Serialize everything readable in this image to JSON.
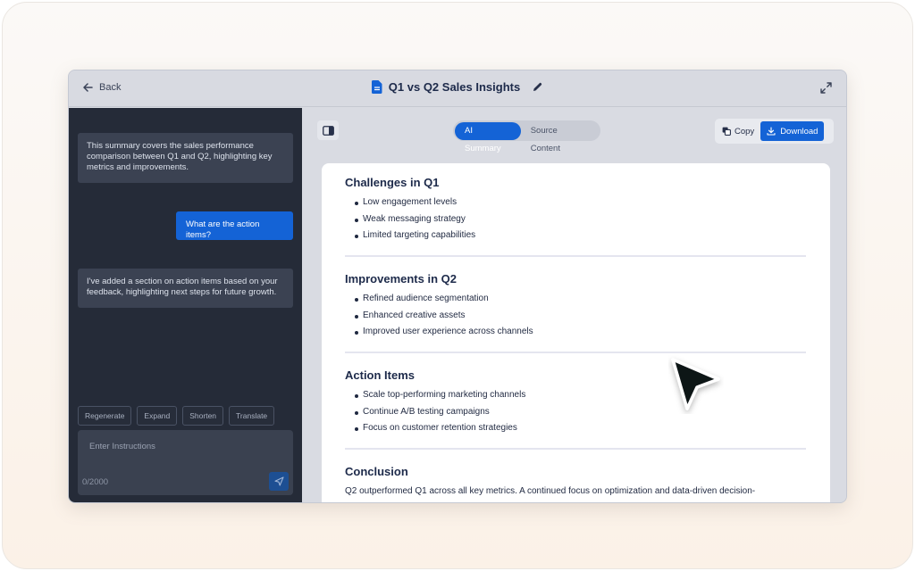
{
  "header": {
    "back_label": "Back",
    "title": "Q1 vs Q2 Sales Insights"
  },
  "chat": {
    "messages": [
      {
        "role": "ai",
        "text": "This summary covers the sales performance comparison between Q1 and Q2, highlighting key metrics and improvements."
      },
      {
        "role": "user",
        "text": "What are the action items?"
      },
      {
        "role": "ai",
        "text": "I've added a section on action items based on your feedback, highlighting next steps for future growth."
      }
    ],
    "quick_actions": [
      "Regenerate",
      "Expand",
      "Shorten",
      "Translate"
    ],
    "input_placeholder": "Enter Instructions",
    "char_count": "0/2000"
  },
  "toolbar": {
    "tabs": [
      {
        "label": "AI Summary",
        "active": true
      },
      {
        "label": "Source Content",
        "active": false
      }
    ],
    "copy_label": "Copy",
    "download_label": "Download"
  },
  "document": {
    "sections": [
      {
        "heading": "Challenges in Q1",
        "items": [
          "Low engagement levels",
          "Weak messaging strategy",
          "Limited targeting capabilities"
        ]
      },
      {
        "heading": "Improvements in Q2",
        "items": [
          "Refined audience segmentation",
          "Enhanced creative assets",
          "Improved user experience across channels"
        ]
      },
      {
        "heading": "Action Items",
        "items": [
          "Scale top-performing marketing channels",
          "Continue A/B testing campaigns",
          "Focus on customer retention strategies"
        ]
      },
      {
        "heading": "Conclusion",
        "text": "Q2 outperformed Q1 across all key metrics. A continued focus on optimization and data-driven decision-"
      }
    ]
  },
  "colors": {
    "accent": "#1463d6",
    "sidebar_bg": "#252b38",
    "heading": "#1d2a4a"
  }
}
